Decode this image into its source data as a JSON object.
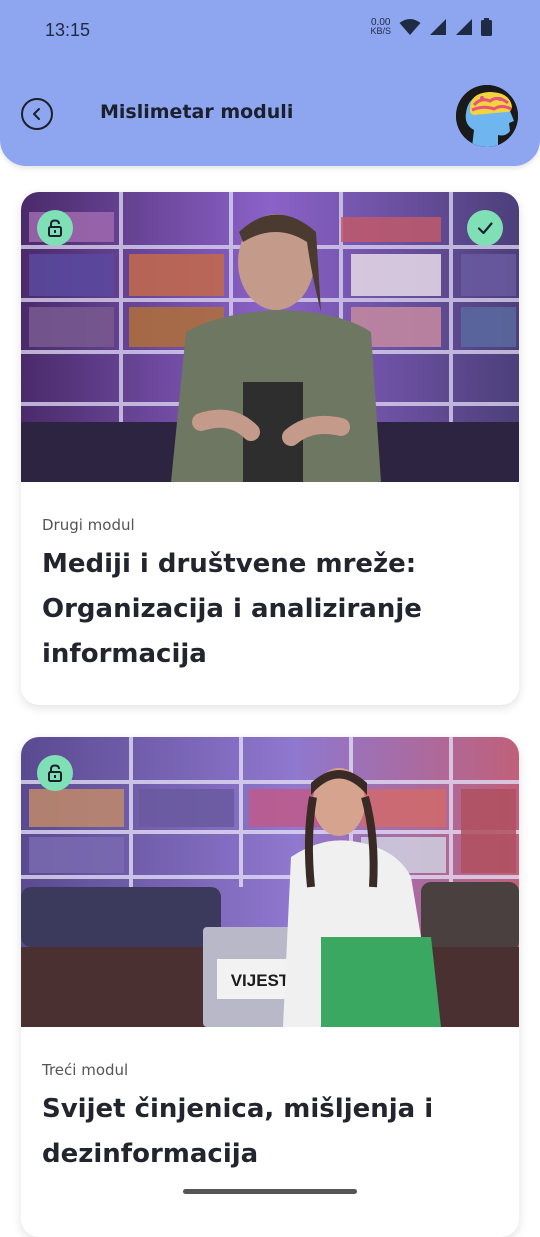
{
  "status_bar": {
    "time": "13:15",
    "net_speed_value": "0.00",
    "net_speed_unit": "KB/S",
    "icons": [
      "wifi-icon",
      "signal-icon",
      "signal-icon",
      "battery-icon"
    ]
  },
  "header": {
    "title": "Mislimetar moduli",
    "back_icon": "back-arrow-icon",
    "avatar_icon": "brain-head-avatar",
    "color": "#8ea6ef"
  },
  "modules": [
    {
      "label": "Drugi modul",
      "title": "Mediji i društvene mreže: Organizacija i analiziranje informacija",
      "badges": [
        "unlock-icon",
        "check-icon"
      ]
    },
    {
      "label": "Treći modul",
      "title": "Svijet činjenica, mišljenja i dezinformacija",
      "badges": [
        "unlock-icon"
      ],
      "image_sign": "VIJEST"
    }
  ],
  "colors": {
    "badge": "#7fe0b5",
    "text_dark": "#23252e"
  }
}
